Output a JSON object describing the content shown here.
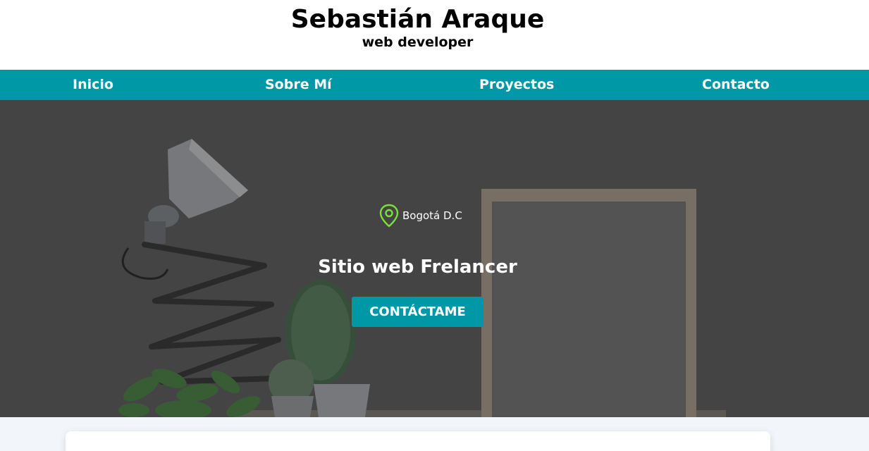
{
  "header": {
    "title": "Sebastián Araque",
    "subtitle": "web developer"
  },
  "nav": {
    "items": [
      {
        "label": "Inicio"
      },
      {
        "label": "Sobre Mí"
      },
      {
        "label": "Proyectos"
      },
      {
        "label": "Contacto"
      }
    ]
  },
  "hero": {
    "location": "Bogotá D.C",
    "location_icon": "map-pin-icon",
    "title": "Sitio web Frelancer",
    "cta_label": "CONTÁCTAME",
    "background_image": "desk-lamp-cactus-frame-photo"
  },
  "colors": {
    "accent": "#0097a7",
    "pin": "#7ddf3c",
    "page_bg": "#f2f5f9"
  }
}
